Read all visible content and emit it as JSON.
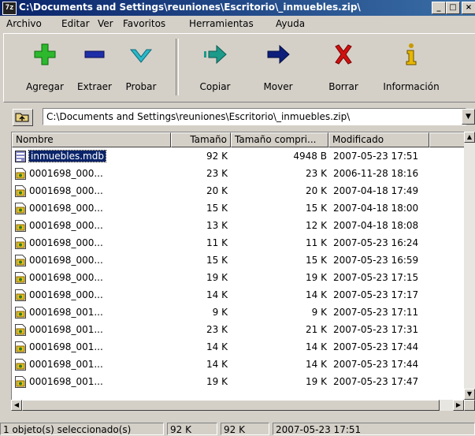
{
  "window": {
    "app_icon": "7z",
    "title": "C:\\Documents and Settings\\reuniones\\Escritorio\\_inmuebles.zip\\",
    "minimize": "_",
    "maximize": "□",
    "close": "×"
  },
  "menu": [
    "Archivo",
    "Editar",
    "Ver",
    "Favoritos",
    "Herramientas",
    "Ayuda"
  ],
  "toolbar": {
    "add": "Agregar",
    "extract": "Extraer",
    "test": "Probar",
    "copy": "Copiar",
    "move": "Mover",
    "delete": "Borrar",
    "info": "Información",
    "colors": {
      "add": "#2db82d",
      "extract": "#1f2fa8",
      "test": "#2ab8c8",
      "copy": "#1c9a8a",
      "move": "#0d1f7a",
      "delete": "#d01010",
      "info": "#c89a00"
    }
  },
  "address": {
    "path": "C:\\Documents and Settings\\reuniones\\Escritorio\\_inmuebles.zip\\"
  },
  "columns": {
    "name": "Nombre",
    "size": "Tamaño",
    "packed": "Tamaño compri...",
    "modified": "Modificado"
  },
  "files": [
    {
      "name": "inmuebles.mdb",
      "size": "92 K",
      "packed": "4948 B",
      "modified": "2007-05-23 17:51",
      "icon": "database-icon"
    },
    {
      "name": "0001698_000...",
      "size": "23 K",
      "packed": "23 K",
      "modified": "2006-11-28 18:16",
      "icon": "image-file-icon"
    },
    {
      "name": "0001698_000...",
      "size": "20 K",
      "packed": "20 K",
      "modified": "2007-04-18 17:49",
      "icon": "image-file-icon"
    },
    {
      "name": "0001698_000...",
      "size": "15 K",
      "packed": "15 K",
      "modified": "2007-04-18 18:00",
      "icon": "image-file-icon"
    },
    {
      "name": "0001698_000...",
      "size": "13 K",
      "packed": "12 K",
      "modified": "2007-04-18 18:08",
      "icon": "image-file-icon"
    },
    {
      "name": "0001698_000...",
      "size": "11 K",
      "packed": "11 K",
      "modified": "2007-05-23 16:24",
      "icon": "image-file-icon"
    },
    {
      "name": "0001698_000...",
      "size": "15 K",
      "packed": "15 K",
      "modified": "2007-05-23 16:59",
      "icon": "image-file-icon"
    },
    {
      "name": "0001698_000...",
      "size": "19 K",
      "packed": "19 K",
      "modified": "2007-05-23 17:15",
      "icon": "image-file-icon"
    },
    {
      "name": "0001698_000...",
      "size": "14 K",
      "packed": "14 K",
      "modified": "2007-05-23 17:17",
      "icon": "image-file-icon"
    },
    {
      "name": "0001698_001...",
      "size": "9 K",
      "packed": "9 K",
      "modified": "2007-05-23 17:11",
      "icon": "image-file-icon"
    },
    {
      "name": "0001698_001...",
      "size": "23 K",
      "packed": "21 K",
      "modified": "2007-05-23 17:31",
      "icon": "image-file-icon"
    },
    {
      "name": "0001698_001...",
      "size": "14 K",
      "packed": "14 K",
      "modified": "2007-05-23 17:44",
      "icon": "image-file-icon"
    },
    {
      "name": "0001698_001...",
      "size": "14 K",
      "packed": "14 K",
      "modified": "2007-05-23 17:44",
      "icon": "image-file-icon"
    },
    {
      "name": "0001698_001...",
      "size": "19 K",
      "packed": "19 K",
      "modified": "2007-05-23 17:47",
      "icon": "image-file-icon"
    }
  ],
  "status": {
    "selection": "1 objeto(s) seleccionado(s)",
    "size": "92 K",
    "packed": "92 K",
    "modified": "2007-05-23 17:51"
  }
}
